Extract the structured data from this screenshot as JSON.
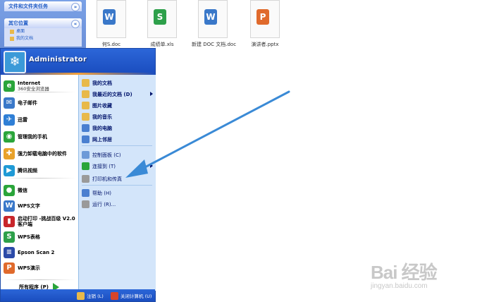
{
  "task_pane": {
    "group1_title": "文件和文件夹任务",
    "group2_title": "其它位置",
    "group2_items": [
      "桌面",
      "我的文档"
    ]
  },
  "files": [
    {
      "name": "何S.doc",
      "badge": "W",
      "color": "#3a78c9"
    },
    {
      "name": "成绩单.xls",
      "badge": "S",
      "color": "#2da04a"
    },
    {
      "name": "新建 DOC 文档.doc",
      "badge": "W",
      "color": "#3a78c9"
    },
    {
      "name": "演讲者.pptx",
      "badge": "P",
      "color": "#e06a2c"
    }
  ],
  "start_menu": {
    "user_name": "Administrator",
    "left_items": [
      {
        "title": "Internet",
        "subtitle": "360安全浏览器",
        "icon": "browser-icon",
        "color": "#2aa53a"
      },
      {
        "title": "电子邮件",
        "subtitle": "",
        "icon": "mail-icon",
        "color": "#3a78c9"
      },
      {
        "title": "迅雷",
        "subtitle": "",
        "icon": "thunder-icon",
        "color": "#2f7fd6"
      },
      {
        "title": "管理我的手机",
        "subtitle": "",
        "icon": "phone-icon",
        "color": "#2aa53a"
      },
      {
        "title": "强力卸载电脑中的软件",
        "subtitle": "",
        "icon": "uninstall-icon",
        "color": "#e8a12a"
      },
      {
        "title": "腾讯视频",
        "subtitle": "",
        "icon": "video-icon",
        "color": "#1f9ad6"
      },
      {
        "title": "微信",
        "subtitle": "",
        "icon": "wechat-icon",
        "color": "#2aa53a"
      },
      {
        "title": "WPS文字",
        "subtitle": "",
        "icon": "wps-writer-icon",
        "color": "#3a78c9"
      },
      {
        "title": "启动打印 -挑战百级 V2.0客户端",
        "subtitle": "",
        "icon": "print-tool-icon",
        "color": "#c8262b"
      },
      {
        "title": "WPS表格",
        "subtitle": "",
        "icon": "wps-sheet-icon",
        "color": "#2da04a"
      },
      {
        "title": "Epson Scan 2",
        "subtitle": "",
        "icon": "scanner-icon",
        "color": "#2b4aa8"
      },
      {
        "title": "WPS演示",
        "subtitle": "",
        "icon": "wps-present-icon",
        "color": "#e06a2c"
      }
    ],
    "glyphs": [
      "e",
      "✉",
      "✈",
      "◉",
      "✚",
      "▶",
      "●",
      "W",
      "▮",
      "S",
      "≡",
      "P"
    ],
    "all_programs": "所有程序 (P)",
    "right_items": [
      {
        "label": "我的文档",
        "bold": true,
        "submenu": false,
        "icon": "folder-docs-icon",
        "color": "#e8b94a"
      },
      {
        "label": "我最近的文档 (D)",
        "bold": true,
        "submenu": true,
        "icon": "recent-docs-icon",
        "color": "#e8b94a"
      },
      {
        "label": "图片收藏",
        "bold": true,
        "submenu": false,
        "icon": "pictures-icon",
        "color": "#e8b94a"
      },
      {
        "label": "我的音乐",
        "bold": true,
        "submenu": false,
        "icon": "music-icon",
        "color": "#e8b94a"
      },
      {
        "label": "我的电脑",
        "bold": true,
        "submenu": false,
        "icon": "computer-icon",
        "color": "#4a7fd0"
      },
      {
        "label": "网上邻居",
        "bold": true,
        "submenu": false,
        "icon": "network-icon",
        "color": "#4a7fd0"
      },
      {
        "label": "控制面板 (C)",
        "bold": false,
        "submenu": false,
        "icon": "control-panel-icon",
        "color": "#6d9ad8"
      },
      {
        "label": "连接到 (T)",
        "bold": false,
        "submenu": true,
        "icon": "connect-icon",
        "color": "#2aa53a"
      },
      {
        "label": "打印机和传真",
        "bold": false,
        "submenu": false,
        "icon": "printer-icon",
        "color": "#9a9a9a"
      },
      {
        "label": "帮助 (H)",
        "bold": false,
        "submenu": false,
        "icon": "help-icon",
        "color": "#4a7fd0"
      },
      {
        "label": "运行 (R)...",
        "bold": false,
        "submenu": false,
        "icon": "run-icon",
        "color": "#9a9a9a"
      }
    ],
    "logoff": "注销 (L)",
    "shutdown": "关闭计算机 (U)"
  },
  "watermark": {
    "main": "Bai 经验",
    "sub": "jingyan.baidu.com"
  },
  "colors": {
    "xp_blue": "#1b4ec0",
    "annotation_arrow": "#3a8ad6"
  }
}
